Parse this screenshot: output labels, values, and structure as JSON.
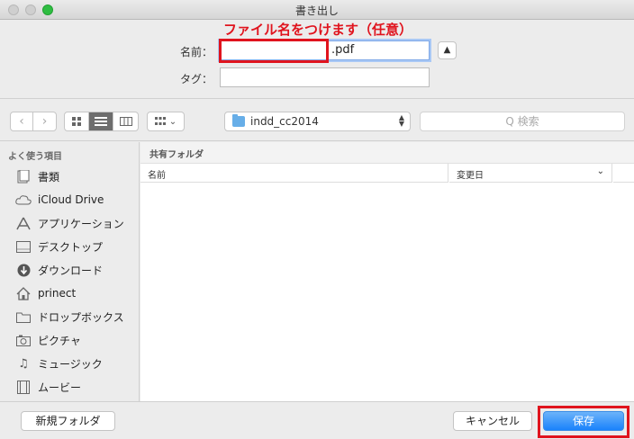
{
  "window": {
    "title": "書き出し"
  },
  "annotation": {
    "text": "ファイル名をつけます（任意）",
    "color": "#e0141e"
  },
  "form": {
    "name_label": "名前：",
    "name_value": "",
    "name_extension": ".pdf",
    "tag_label": "タグ：",
    "tag_value": ""
  },
  "toolbar": {
    "back_icon": "chevron-left-icon",
    "forward_icon": "chevron-right-icon",
    "location": "indd_cc2014",
    "search_placeholder": "Q 検索"
  },
  "sidebar": {
    "heading": "よく使う項目",
    "items": [
      {
        "label": "書類",
        "icon": "documents-icon"
      },
      {
        "label": "iCloud Drive",
        "icon": "cloud-icon"
      },
      {
        "label": "アプリケーション",
        "icon": "applications-icon"
      },
      {
        "label": "デスクトップ",
        "icon": "desktop-icon"
      },
      {
        "label": "ダウンロード",
        "icon": "download-icon"
      },
      {
        "label": "prinect",
        "icon": "home-icon"
      },
      {
        "label": "ドロップボックス",
        "icon": "folder-icon"
      },
      {
        "label": "ピクチャ",
        "icon": "camera-icon"
      },
      {
        "label": "ミュージック",
        "icon": "music-icon"
      },
      {
        "label": "ムービー",
        "icon": "film-icon"
      }
    ]
  },
  "main": {
    "section": "共有フォルダ",
    "columns": {
      "name": "名前",
      "date": "変更日"
    }
  },
  "buttons": {
    "new_folder": "新規フォルダ",
    "cancel": "キャンセル",
    "save": "保存"
  },
  "colors": {
    "accent": "#1a82fb",
    "highlight_red": "#e0141e"
  }
}
